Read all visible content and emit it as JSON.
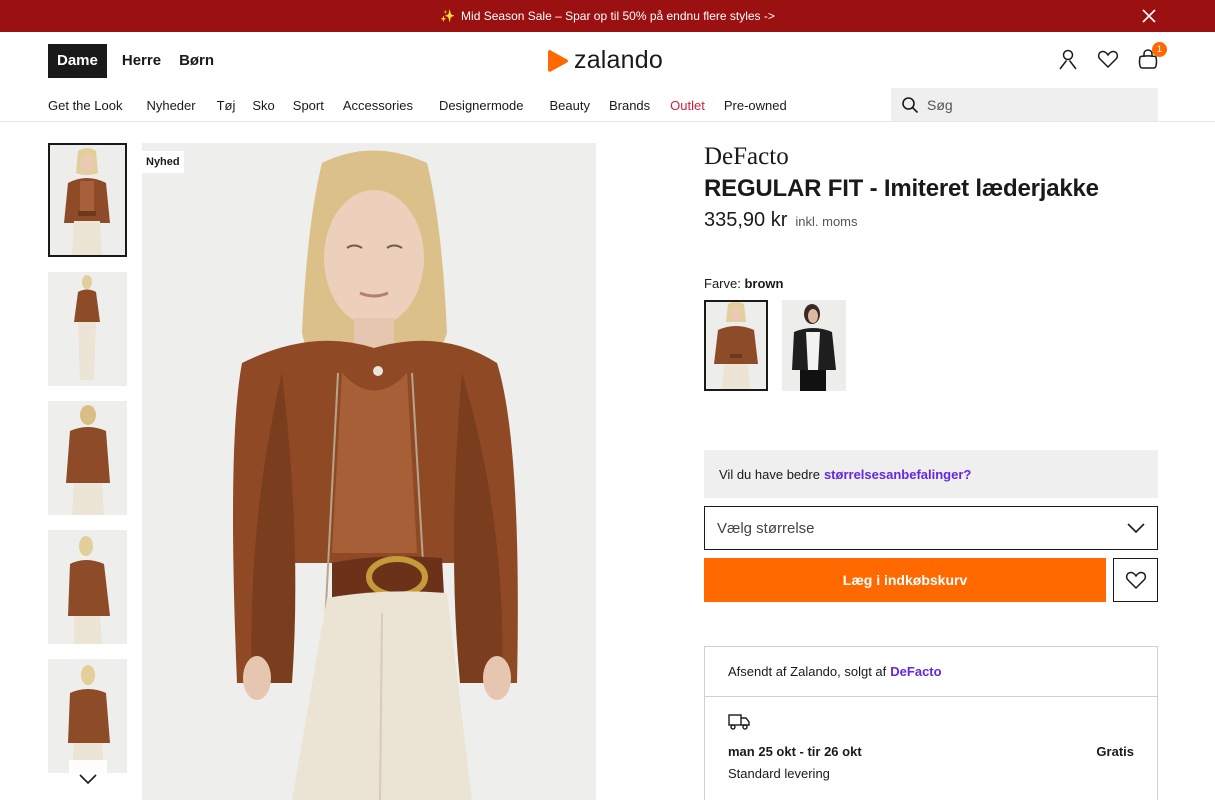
{
  "promo": {
    "text": "Mid Season Sale – Spar op til 50% på endnu flere styles ->",
    "icon": "sparkle-icon",
    "background": "#9b1112"
  },
  "header": {
    "gender_tabs": [
      "Dame",
      "Herre",
      "Børn"
    ],
    "logo_text": "zalando",
    "logo_color": "#ff6900",
    "cart_count": "1",
    "icons": [
      "user-icon",
      "heart-icon",
      "bag-icon"
    ]
  },
  "nav": {
    "items": [
      "Get the Look",
      "Nyheder",
      "Tøj",
      "Sko",
      "Sport",
      "Accessories",
      "Designermode",
      "Beauty",
      "Brands",
      "Outlet",
      "Pre-owned"
    ]
  },
  "search": {
    "placeholder": "Søg"
  },
  "gallery": {
    "badge": "Nyhed",
    "thumb_count": 5,
    "active_thumb": 0
  },
  "product": {
    "brand": "DeFacto",
    "title": "REGULAR FIT - Imiteret læderjakke",
    "price": "335,90 kr",
    "vat": "inkl. moms",
    "color_label": "Farve:",
    "color_value": "brown",
    "swatches": [
      "brown",
      "black"
    ]
  },
  "size": {
    "reco_text": "Vil du have bedre",
    "reco_link": "størrelsesanbefalinger?",
    "select_label": "Vælg størrelse"
  },
  "cart": {
    "add_label": "Læg i indkøbskurv",
    "accent": "#ff6900"
  },
  "shipping": {
    "seller_text": "Afsendt af Zalando, solgt af",
    "seller_link": "DeFacto",
    "dates": "man 25 okt - tir 26 okt",
    "price": "Gratis",
    "type": "Standard levering"
  }
}
